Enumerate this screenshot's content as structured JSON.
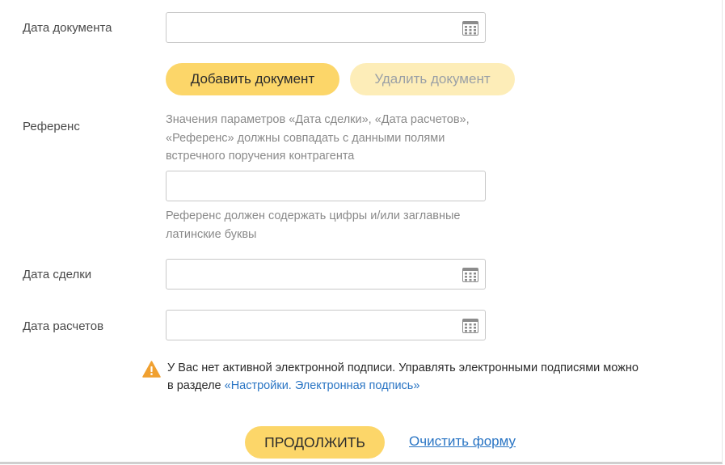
{
  "form": {
    "document_date": {
      "label": "Дата документа",
      "value": ""
    },
    "add_document_label": "Добавить документ",
    "delete_document_label": "Удалить документ",
    "reference": {
      "label": "Референс",
      "note_line1": "Значения параметров «Дата сделки», «Дата расчетов»,",
      "note_line2": "«Референс» должны совпадать с данными полями",
      "note_line3": "встречного поручения контрагента",
      "value": "",
      "hint_line1": "Референс должен содержать цифры и/или заглавные",
      "hint_line2": "латинские буквы"
    },
    "deal_date": {
      "label": "Дата сделки",
      "value": ""
    },
    "settlement_date": {
      "label": "Дата расчетов",
      "value": ""
    }
  },
  "warning": {
    "text_line1": "У Вас нет активной электронной подписи. Управлять электронными подписями можно",
    "text_line2_prefix": "в разделе ",
    "link": "«Настройки. Электронная подпись»",
    "icon": "warning-triangle-icon",
    "icon_color": "#f0a030"
  },
  "actions": {
    "continue_label": "ПРОДОЛЖИТЬ",
    "clear_label": "Очистить форму"
  },
  "colors": {
    "primary_button": "#fcd669",
    "disabled_button": "#fdedb8",
    "link": "#2a75c4"
  }
}
